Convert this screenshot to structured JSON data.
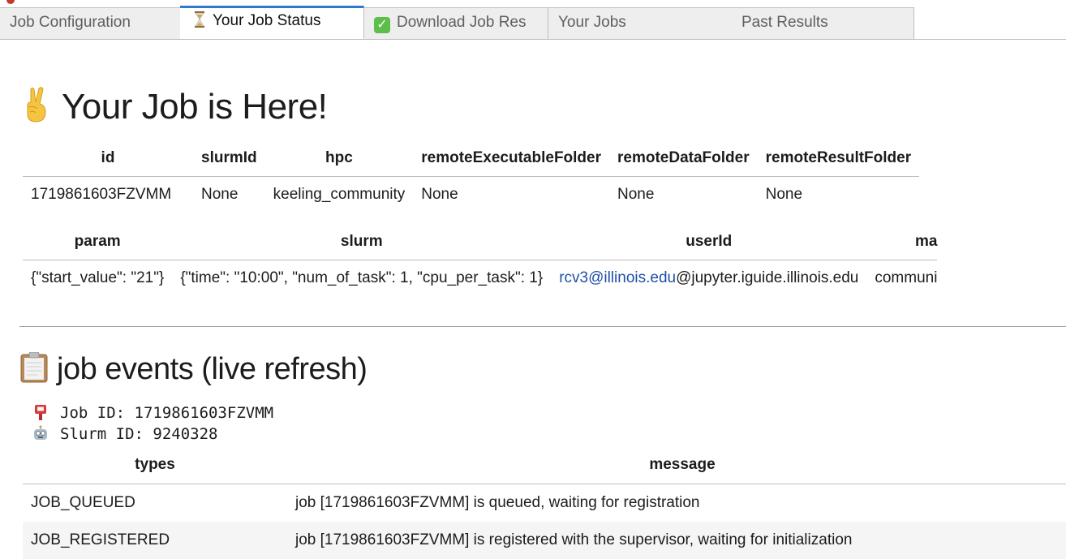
{
  "tabs": [
    {
      "label": "Job Configuration",
      "icon": "",
      "active": false
    },
    {
      "label": "Your Job Status",
      "icon": "hourglass-icon",
      "active": true
    },
    {
      "label": "Download Job Res",
      "icon": "check-mark-icon",
      "active": false
    },
    {
      "label": "Your Jobs",
      "icon": "",
      "active": false
    },
    {
      "label": "Past Results",
      "icon": "",
      "active": false
    }
  ],
  "job_section": {
    "title": "Your Job is Here!",
    "title_icon": "victory-hand-icon",
    "table1": {
      "headers": [
        "id",
        "slurmId",
        "hpc",
        "remoteExecutableFolder",
        "remoteDataFolder",
        "remoteResultFolder"
      ],
      "row": [
        "1719861603FZVMM",
        "None",
        "keeling_community",
        "None",
        "None",
        "None"
      ]
    },
    "table2": {
      "headers": [
        "param",
        "slurm",
        "userId",
        "ma"
      ],
      "row": {
        "param": "{\"start_value\": \"21\"}",
        "slurm": "{\"time\": \"10:00\", \"num_of_task\": 1, \"cpu_per_task\": 1}",
        "userId_link": "rcv3@illinois.edu",
        "userId_rest": "@jupyter.iguide.illinois.edu",
        "ma": "communi"
      }
    }
  },
  "events_section": {
    "title": "job events (live refresh)",
    "title_icon": "clipboard-icon",
    "job_id_label": "Job ID: 1719861603FZVMM",
    "job_id_icon": "postbox-icon",
    "slurm_id_label": "Slurm ID: 9240328",
    "slurm_id_icon": "robot-icon",
    "table": {
      "headers": [
        "types",
        "message"
      ],
      "rows": [
        {
          "type": "JOB_QUEUED",
          "message": "job [1719861603FZVMM] is queued, waiting for registration"
        },
        {
          "type": "JOB_REGISTERED",
          "message": "job [1719861603FZVMM] is registered with the supervisor, waiting for initialization"
        }
      ]
    }
  },
  "colors": {
    "active_tab_accent": "#2f7ad1",
    "link": "#1f4fa8",
    "tab_bg": "#eeeeee"
  }
}
